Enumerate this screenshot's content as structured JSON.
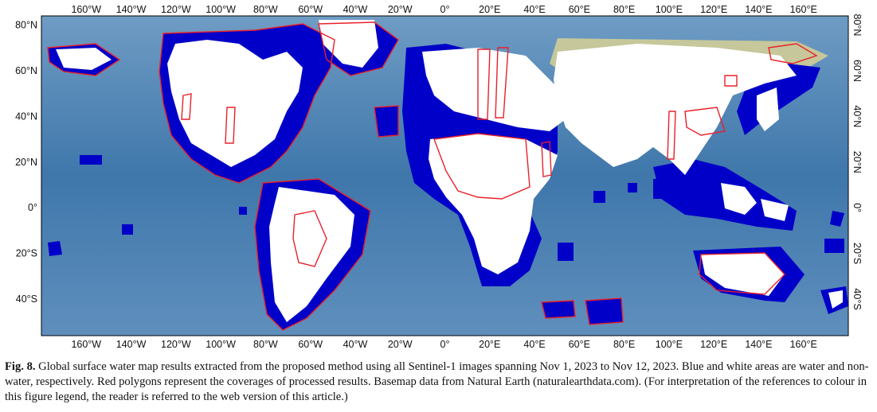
{
  "figure": {
    "label": "Fig. 8.",
    "caption": "Global surface water map results extracted from the proposed method using all Sentinel-1 images spanning Nov 1, 2023 to Nov 12, 2023. Blue and white areas are water and non-water, respectively. Red polygons represent the coverages of processed results. Basemap data from Natural Earth (naturalearthdata.com). (For interpretation of the references to colour in this figure legend, the reader is referred to the web version of this article.)"
  },
  "map": {
    "projection": "equirectangular",
    "lon_range": [
      -180,
      180
    ],
    "lat_range": [
      -56,
      84
    ],
    "lon_ticks": [
      "160°W",
      "140°W",
      "120°W",
      "100°W",
      "80°W",
      "60°W",
      "40°W",
      "20°W",
      "0°",
      "20°E",
      "40°E",
      "60°E",
      "80°E",
      "100°E",
      "120°E",
      "140°E",
      "160°E"
    ],
    "lat_ticks_left": [
      "80°N",
      "60°N",
      "40°N",
      "20°N",
      "0°",
      "20°S",
      "40°S"
    ],
    "lat_ticks_right": [
      "80°N",
      "60°N",
      "40°N",
      "20°N",
      "0°",
      "20°S",
      "40°S"
    ],
    "colors": {
      "water": "#0000c8",
      "non_water": "#ffffff",
      "coverage": "#e8202a",
      "ocean": "#4d7fae",
      "land": "#c9c79a"
    }
  }
}
